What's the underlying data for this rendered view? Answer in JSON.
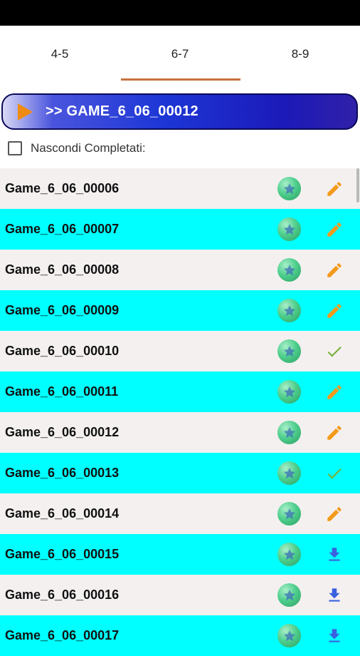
{
  "tabs": [
    {
      "label": "4-5"
    },
    {
      "label": "6-7"
    },
    {
      "label": "8-9"
    }
  ],
  "selected_tab": "6-7",
  "banner": {
    "label": ">> GAME_6_06_00012"
  },
  "filter": {
    "label": "Nascondi Completati:",
    "checked": false
  },
  "colors": {
    "row_light": "#f4f0f0",
    "row_cyan": "#00ffff",
    "tab_indicator": "#c8703e",
    "pencil": "#f39a1b",
    "check": "#78b23a",
    "download": "#3a62e0"
  },
  "games": [
    {
      "name": "Game_6_06_00006",
      "status_icon": "pencil-icon"
    },
    {
      "name": "Game_6_06_00007",
      "status_icon": "pencil-icon"
    },
    {
      "name": "Game_6_06_00008",
      "status_icon": "pencil-icon"
    },
    {
      "name": "Game_6_06_00009",
      "status_icon": "pencil-icon"
    },
    {
      "name": "Game_6_06_00010",
      "status_icon": "check-icon"
    },
    {
      "name": "Game_6_06_00011",
      "status_icon": "pencil-icon"
    },
    {
      "name": "Game_6_06_00012",
      "status_icon": "pencil-icon"
    },
    {
      "name": "Game_6_06_00013",
      "status_icon": "check-icon"
    },
    {
      "name": "Game_6_06_00014",
      "status_icon": "pencil-icon"
    },
    {
      "name": "Game_6_06_00015",
      "status_icon": "download-icon"
    },
    {
      "name": "Game_6_06_00016",
      "status_icon": "download-icon"
    },
    {
      "name": "Game_6_06_00017",
      "status_icon": "download-icon"
    }
  ]
}
